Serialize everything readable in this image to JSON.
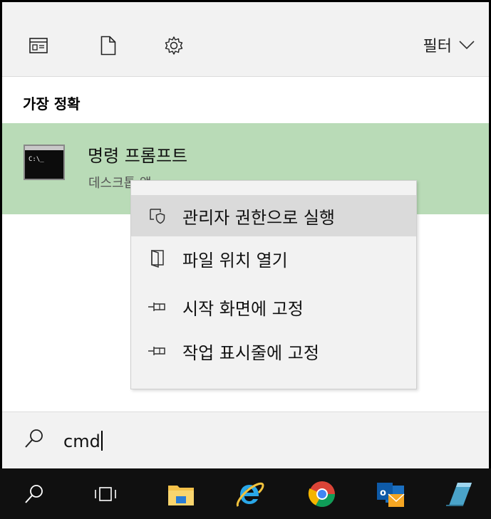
{
  "toolbar": {
    "icons": [
      "document-view-icon",
      "file-icon",
      "gear-icon"
    ],
    "filter_label": "필터"
  },
  "best_match": {
    "section_title": "가장 정확",
    "app_name": "명령 프롬프트",
    "app_type": "데스크톱 앱",
    "icon_text": "C:\\_"
  },
  "context_menu": {
    "items": [
      {
        "label": "관리자 권한으로 실행",
        "icon": "shield-run-icon"
      },
      {
        "label": "파일 위치 열기",
        "icon": "folder-open-icon"
      },
      {
        "label": "시작 화면에 고정",
        "icon": "pin-icon"
      },
      {
        "label": "작업 표시줄에 고정",
        "icon": "pin-icon"
      }
    ]
  },
  "search": {
    "value": "cmd"
  },
  "taskbar": {
    "icons": [
      "search-icon",
      "task-view-icon",
      "file-explorer-icon",
      "internet-explorer-icon",
      "chrome-icon",
      "outlook-icon",
      "notes-icon"
    ]
  },
  "colors": {
    "highlight": "#b9dbb7",
    "panel": "#f2f2f2",
    "taskbar": "#101010"
  }
}
